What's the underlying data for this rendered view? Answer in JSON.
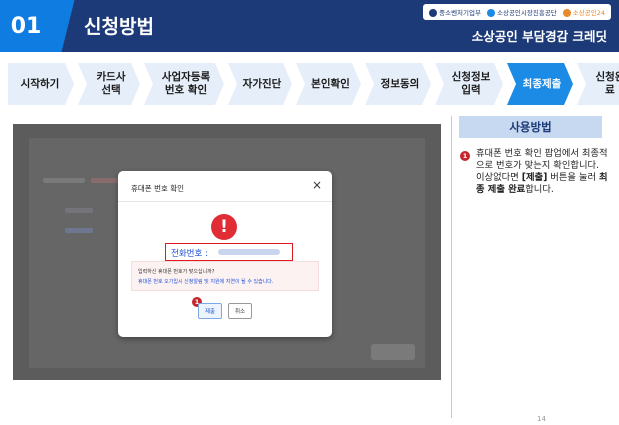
{
  "header": {
    "section_number": "01",
    "title": "신청방법",
    "subtitle": "소상공인 부담경감 크레딧",
    "logos": [
      {
        "label": "중소벤처기업부",
        "color": "#1d3a78"
      },
      {
        "label": "소상공인시장진흥공단",
        "color": "#1b8be6"
      },
      {
        "label": "소상공인24",
        "color": "#e8892b"
      }
    ]
  },
  "steps": [
    {
      "label": "시작하기",
      "active": false
    },
    {
      "label": "카드사\n선택",
      "active": false
    },
    {
      "label": "사업자등록\n번호 확인",
      "active": false
    },
    {
      "label": "자가진단",
      "active": false
    },
    {
      "label": "본인확인",
      "active": false
    },
    {
      "label": "정보동의",
      "active": false
    },
    {
      "label": "신청정보\n입력",
      "active": false
    },
    {
      "label": "최종제출",
      "active": true
    },
    {
      "label": "신청완료",
      "active": false
    }
  ],
  "modal": {
    "title": "휴대폰 번호 확인",
    "close_glyph": "×",
    "warning_glyph": "!",
    "phone_label": "전화번호 :",
    "message_line1": "입력하신 휴대폰 번호가 맞으십니까?",
    "message_line2": "휴대폰 번호 오기입시 신청알림 및 지원에 지연이 될 수 있습니다.",
    "submit_label": "제출",
    "cancel_label": "취소",
    "step_badge": "1"
  },
  "howto": {
    "title": "사용방법",
    "badge": "1",
    "line1": "휴대폰 번호 확인 팝업에서 최종적으로 번호가 맞는지 확인합니다.",
    "line2_pre": "이상없다면 ",
    "line2_bold1": "[제출]",
    "line2_mid": " 버튼을 눌러 ",
    "line2_bold2": "최종 제출 완료",
    "line2_post": "합니다."
  },
  "page_number": "14",
  "colors": {
    "header_bg": "#1d3a78",
    "accent_blue": "#1b8be6",
    "step_bg": "#e6eef9",
    "warning_red": "#e02c35"
  }
}
